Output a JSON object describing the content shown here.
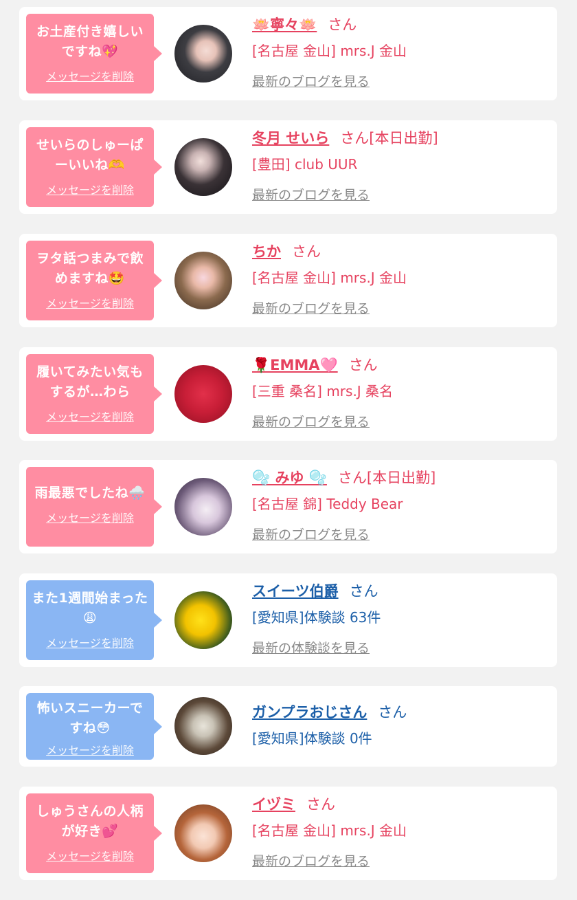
{
  "items": [
    {
      "message": "お土産付き嬉しいですね💖",
      "delete_label": "メッセージを削除",
      "name": "🪷寧々🪷",
      "suffix": "さん",
      "shop": "[名古屋 金山] mrs.J 金山",
      "blog_link": "最新のブログを見る"
    },
    {
      "message": "せいらのしゅーぱーいいね🫶",
      "delete_label": "メッセージを削除",
      "name": "冬月 せいら",
      "suffix": "さん[本日出勤]",
      "shop": "[豊田] club UUR",
      "blog_link": "最新のブログを見る"
    },
    {
      "message": "ヲタ話つまみで飲めますね🤩",
      "delete_label": "メッセージを削除",
      "name": "ちか",
      "suffix": "さん",
      "shop": "[名古屋 金山] mrs.J 金山",
      "blog_link": "最新のブログを見る"
    },
    {
      "message": "履いてみたい気もするが…わら",
      "delete_label": "メッセージを削除",
      "name": "🌹EMMA🩷",
      "suffix": "さん",
      "shop": "[三重 桑名] mrs.J 桑名",
      "blog_link": "最新のブログを見る"
    },
    {
      "message": "雨最悪でしたね🌧️",
      "delete_label": "メッセージを削除",
      "name": "🫧 みゆ 🫧",
      "suffix": "さん[本日出勤]",
      "shop": "[名古屋 錦] Teddy Bear",
      "blog_link": "最新のブログを見る"
    },
    {
      "message": "また1週間始まった😩",
      "delete_label": "メッセージを削除",
      "name": "スイーツ伯爵",
      "suffix": "さん",
      "shop": "[愛知県]体験談 63件",
      "blog_link": "最新の体験談を見る"
    },
    {
      "message": "怖いスニーカーですね😳",
      "delete_label": "メッセージを削除",
      "name": "ガンプラおじさん",
      "suffix": "さん",
      "shop": "[愛知県]体験談 0件"
    },
    {
      "message": "しゅうさんの人柄が好き💕",
      "delete_label": "メッセージを削除",
      "name": "イヅミ",
      "suffix": "さん",
      "shop": "[名古屋 金山] mrs.J 金山",
      "blog_link": "最新のブログを見る"
    }
  ]
}
